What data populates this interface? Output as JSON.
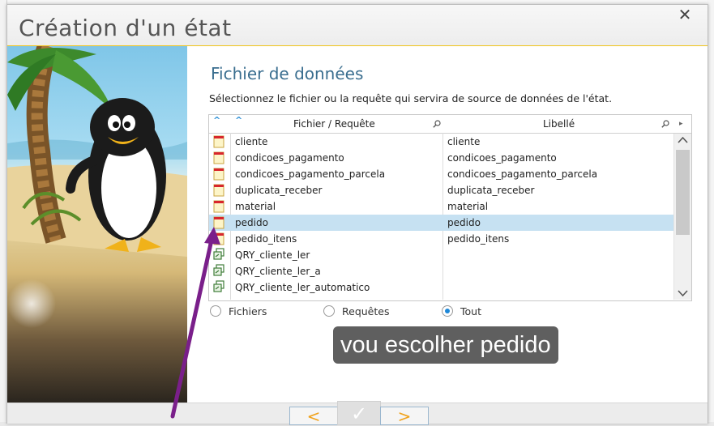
{
  "dialog": {
    "title": "Création d'un état",
    "close_label": "✕"
  },
  "content": {
    "heading": "Fichier de données",
    "instruction": "Sélectionnez le fichier ou la requête qui servira de source de données de l'état."
  },
  "table": {
    "columns": [
      "Fichier / Requête",
      "Libellé"
    ],
    "rows": [
      {
        "type": "file",
        "name": "cliente",
        "label": "cliente"
      },
      {
        "type": "file",
        "name": "condicoes_pagamento",
        "label": "condicoes_pagamento"
      },
      {
        "type": "file",
        "name": "condicoes_pagamento_parcela",
        "label": "condicoes_pagamento_parcela"
      },
      {
        "type": "file",
        "name": "duplicata_receber",
        "label": "duplicata_receber"
      },
      {
        "type": "file",
        "name": "material",
        "label": "material"
      },
      {
        "type": "file",
        "name": "pedido",
        "label": "pedido",
        "selected": true
      },
      {
        "type": "file",
        "name": "pedido_itens",
        "label": "pedido_itens"
      },
      {
        "type": "query",
        "name": "QRY_cliente_ler",
        "label": ""
      },
      {
        "type": "query",
        "name": "QRY_cliente_ler_a",
        "label": ""
      },
      {
        "type": "query",
        "name": "QRY_cliente_ler_automatico",
        "label": ""
      }
    ]
  },
  "filters": {
    "options": [
      {
        "label": "Fichiers",
        "checked": false
      },
      {
        "label": "Requêtes",
        "checked": false
      },
      {
        "label": "Tout",
        "checked": true
      }
    ]
  },
  "overlay": {
    "caption": "vou escolher pedido"
  },
  "footer": {
    "back_label": "<",
    "ok_label": "✓",
    "next_label": ">"
  },
  "colors": {
    "accent": "#1e88d8",
    "heading": "#3a6e8f",
    "selection": "#c6e1f2",
    "annotation_arrow": "#7a1f8a",
    "title_underline": "#f0c419"
  }
}
